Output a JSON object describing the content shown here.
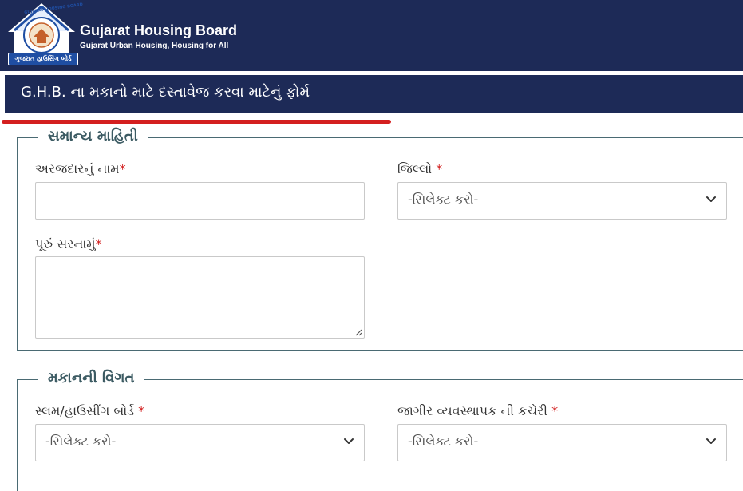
{
  "header": {
    "brand_title": "Gujarat Housing Board",
    "brand_subtitle": "Gujarat Urban Housing, Housing for All",
    "logo_arc_text": "GUJARAT HOUSING BOARD",
    "logo_ribbon_text": "ગુજરાત હાઉસિંગ બોર્ડ"
  },
  "form": {
    "title": "G.H.B. ના મકાનો માટે દસ્તાવેજ કરવા માટેનું ફોર્મ"
  },
  "section_general": {
    "legend": "સમાન્ય માહિતી",
    "applicant_name_label": "અરજદારનું નામ",
    "district_label": "જિલ્લો",
    "district_value": "-સિલેક્ટ કરો-",
    "address_label": "પૂરું સરનામું"
  },
  "section_house": {
    "legend": "મકાનની વિગત",
    "board_label": "સ્લમ/હાઉસીંગ બોર્ડ",
    "board_value": "-સિલેક્ટ કરો-",
    "estate_office_label": "જાગીર વ્યવસ્થાપક ની કચેરી",
    "estate_office_value": "-સિલેક્ટ કરો-"
  },
  "required_marker": "*",
  "colors": {
    "header_bg": "#1d2a57",
    "accent_red": "#d41f1f",
    "legend_text": "#3b5a62"
  }
}
